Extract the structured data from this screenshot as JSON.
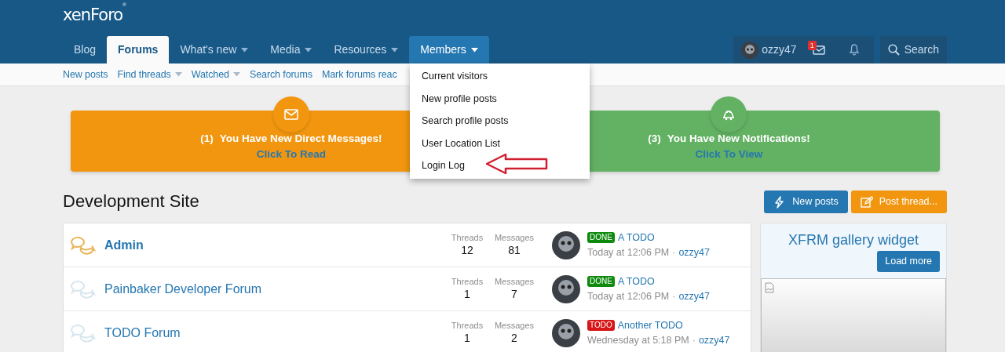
{
  "logo": {
    "text": "xenForo",
    "mark": "®"
  },
  "nav_tabs": [
    {
      "label": "Blog",
      "selected": false,
      "has_menu": false,
      "open": false
    },
    {
      "label": "Forums",
      "selected": true,
      "has_menu": false,
      "open": false
    },
    {
      "label": "What's new",
      "selected": false,
      "has_menu": true,
      "open": false
    },
    {
      "label": "Media",
      "selected": false,
      "has_menu": true,
      "open": false
    },
    {
      "label": "Resources",
      "selected": false,
      "has_menu": true,
      "open": false
    },
    {
      "label": "Members",
      "selected": false,
      "has_menu": true,
      "open": true
    }
  ],
  "user_bar": {
    "username": "ozzy47",
    "message_count": "1",
    "search_label": "Search"
  },
  "sub_nav": [
    {
      "label": "New posts",
      "has_menu": false
    },
    {
      "label": "Find threads",
      "has_menu": true
    },
    {
      "label": "Watched",
      "has_menu": true
    },
    {
      "label": "Search forums",
      "has_menu": false
    },
    {
      "label": "Mark forums reac",
      "has_menu": false
    }
  ],
  "members_menu": [
    "Current visitors",
    "New profile posts",
    "Search profile posts",
    "User Location List",
    "Login Log"
  ],
  "notices": [
    {
      "kind": "messages",
      "count": "(1)",
      "text": "You Have New Direct Messages!",
      "link": "Click To Read",
      "color": "#f2960f"
    },
    {
      "kind": "notifications",
      "count": "(3)",
      "text": "You Have New Notifications!",
      "link": "Click To View",
      "color": "#63b163"
    }
  ],
  "page_title": "Development Site",
  "buttons": [
    {
      "kind": "new-posts",
      "label": "New posts"
    },
    {
      "kind": "post-thread",
      "label": "Post thread..."
    }
  ],
  "forums": [
    {
      "name": "Admin",
      "unread": true,
      "threads_label": "Threads",
      "threads": "12",
      "messages_label": "Messages",
      "messages": "81",
      "prefix": {
        "label": "DONE",
        "color": "#0e8a0e"
      },
      "last_title": "A TODO",
      "last_time": "Today at 12:06 PM",
      "separator": "·",
      "last_user": "ozzy47"
    },
    {
      "name": "Painbaker Developer Forum",
      "unread": false,
      "threads_label": "Threads",
      "threads": "1",
      "messages_label": "Messages",
      "messages": "7",
      "prefix": {
        "label": "DONE",
        "color": "#0e8a0e"
      },
      "last_title": "A TODO",
      "last_time": "Today at 12:06 PM",
      "separator": "·",
      "last_user": "ozzy47"
    },
    {
      "name": "TODO Forum",
      "unread": false,
      "threads_label": "Threads",
      "threads": "1",
      "messages_label": "Messages",
      "messages": "2",
      "prefix": {
        "label": "TODO",
        "color": "#d71717"
      },
      "last_title": "Another TODO",
      "last_time": "Wednesday at 5:18 PM",
      "separator": "·",
      "last_user": "ozzy47"
    }
  ],
  "widget": {
    "title": "XFRM gallery widget",
    "button": "Load more"
  }
}
